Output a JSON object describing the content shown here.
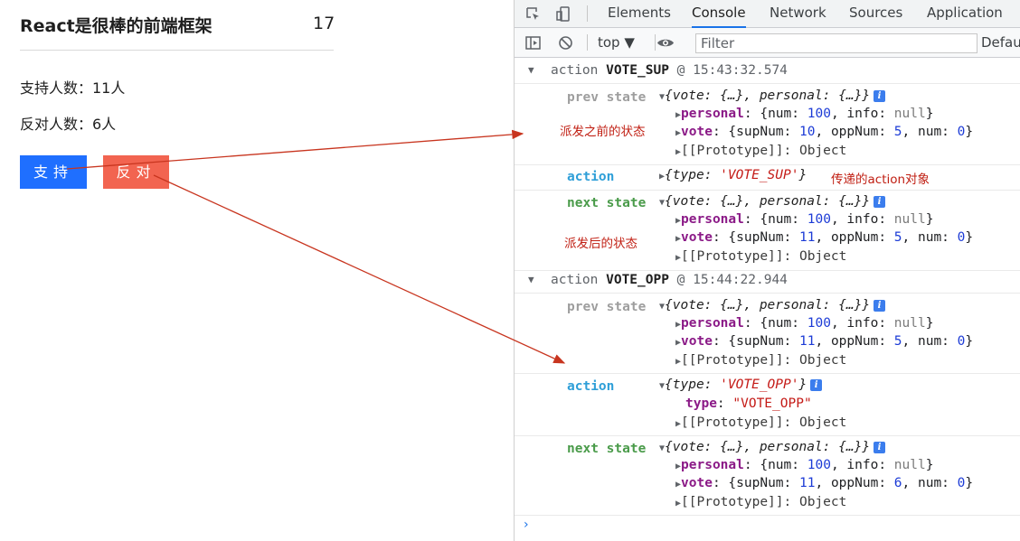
{
  "app": {
    "title": "React是很棒的前端框架",
    "total": "17",
    "support_text": "支持人数：11人",
    "oppose_text": "反对人数：6人",
    "support_button": "支持",
    "oppose_button": "反对"
  },
  "devtools": {
    "tabs": [
      "Elements",
      "Console",
      "Network",
      "Sources",
      "Application"
    ],
    "active_tab": "Console",
    "toolbar": {
      "context": "top ▼",
      "filter_placeholder": "Filter",
      "levels": "Defaul"
    },
    "labels": {
      "prev": "prev state",
      "action": "action",
      "next": "next state"
    },
    "groups": [
      {
        "prefix": "action ",
        "type": "VOTE_SUP",
        "suffix": " @ 15:43:32.574"
      },
      {
        "prefix": "action ",
        "type": "VOTE_OPP",
        "suffix": " @ 15:44:22.944"
      }
    ],
    "text": {
      "summary_open": "{",
      "summary_vote": "vote: {…}",
      "summary_comma": ", ",
      "summary_personal": "personal: {…}",
      "summary_close": "}",
      "personal_key": "personal",
      "vote_key": "vote",
      "type_key": "type",
      "proto": "[[Prototype]]: Object",
      "colon": ": ",
      "brace_open": "{",
      "brace_close": "}",
      "num_label": "num: ",
      "info_label": "info: ",
      "sup_label": "supNum: ",
      "opp_label": "oppNum: ",
      "null_val": "null",
      "comma": ", ",
      "num_100": "100",
      "v1_sup": "10",
      "v1_opp": "5",
      "v1_num": "0",
      "v2_sup": "11",
      "v2_opp": "5",
      "v2_num": "0",
      "v3_sup": "11",
      "v3_opp": "5",
      "v3_num": "0",
      "v4_sup": "11",
      "v4_opp": "6",
      "v4_num": "0",
      "act1": "'VOTE_SUP'",
      "act2": "'VOTE_OPP'",
      "act2_str": "\"VOTE_OPP\"",
      "info_badge": "i",
      "prompt": "›"
    },
    "annotations": {
      "before": "派发之前的状态",
      "action_obj": "传递的action对象",
      "after": "派发后的状态"
    }
  },
  "colors": {
    "support": "#1f6fff",
    "oppose": "#f26450",
    "arrow": "#c8351f",
    "annotation": "#c01e12"
  }
}
